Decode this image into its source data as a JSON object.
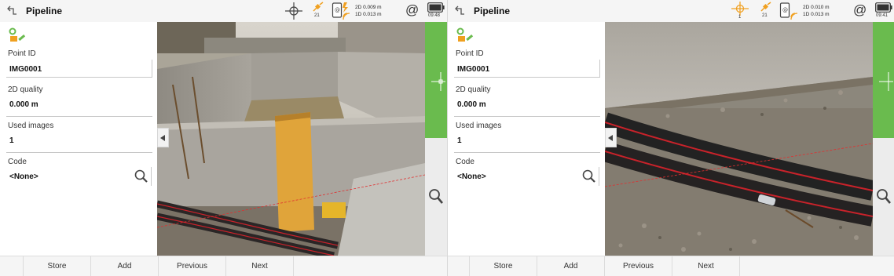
{
  "panels": [
    {
      "title": "Pipeline",
      "status": {
        "satellites": "21",
        "precision_2d": "2D 0.009 m",
        "precision_1d": "1D 0.013 m",
        "at_symbol": "@",
        "time": "09:48"
      },
      "fields": {
        "point_id_label": "Point ID",
        "point_id_value": "IMG0001",
        "quality_label": "2D quality",
        "quality_value": "0.000 m",
        "images_label": "Used images",
        "images_value": "1",
        "code_label": "Code",
        "code_value": "<None>"
      },
      "buttons": {
        "store": "Store",
        "add": "Add",
        "previous": "Previous",
        "next": "Next"
      }
    },
    {
      "title": "Pipeline",
      "status": {
        "crosshair_label": "1",
        "satellites": "21",
        "precision_2d": "2D 0.010 m",
        "precision_1d": "1D 0.013 m",
        "at_symbol": "@",
        "time": "09:41"
      },
      "fields": {
        "point_id_label": "Point ID",
        "point_id_value": "IMG0001",
        "quality_label": "2D quality",
        "quality_value": "0.000 m",
        "images_label": "Used images",
        "images_value": "1",
        "code_label": "Code",
        "code_value": "<None>"
      },
      "buttons": {
        "store": "Store",
        "add": "Add",
        "previous": "Previous",
        "next": "Next"
      }
    }
  ],
  "colors": {
    "accent_green": "#6abb4e",
    "gnss_orange": "#f0a020",
    "pipe_red": "#c8222a"
  },
  "icons": {
    "back": "back-arrow-icon",
    "crosshair": "crosshair-icon",
    "satellite": "satellite-icon",
    "receiver": "receiver-link-icon",
    "at": "at-sign-icon",
    "battery": "battery-icon",
    "form": "point-image-icon",
    "search": "search-icon",
    "collapse": "chevron-left-icon"
  }
}
